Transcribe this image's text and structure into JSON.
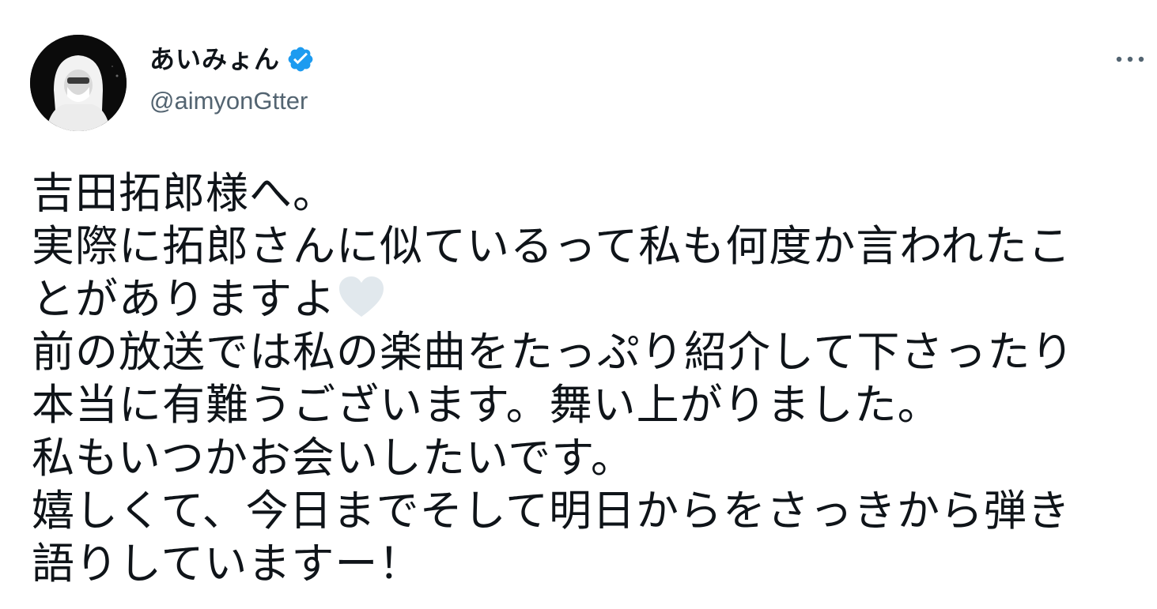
{
  "author": {
    "display_name": "あいみょん",
    "handle": "@aimyonGtter",
    "verified": true,
    "verified_color": "#1d9bf0",
    "avatar_icon": "profile-photo-white-hood"
  },
  "menu": {
    "icon": "more-horizontal-icon"
  },
  "tweet": {
    "lines": [
      "吉田拓郎様へ。",
      "実際に拓郎さんに似ているって私も何度か言われたこ",
      "とがありますよ",
      "前の放送では私の楽曲をたっぷり紹介して下さったり",
      "本当に有難うございます。舞い上がりました。",
      "私もいつかお会いしたいです。",
      "嬉しくて、今日までそして明日からをさっきから弾き",
      "語りしていますー！"
    ],
    "emoji": "white-heart-icon",
    "emoji_color": "#e1e8ed"
  },
  "colors": {
    "text": "#0f1419",
    "secondary": "#536471"
  }
}
